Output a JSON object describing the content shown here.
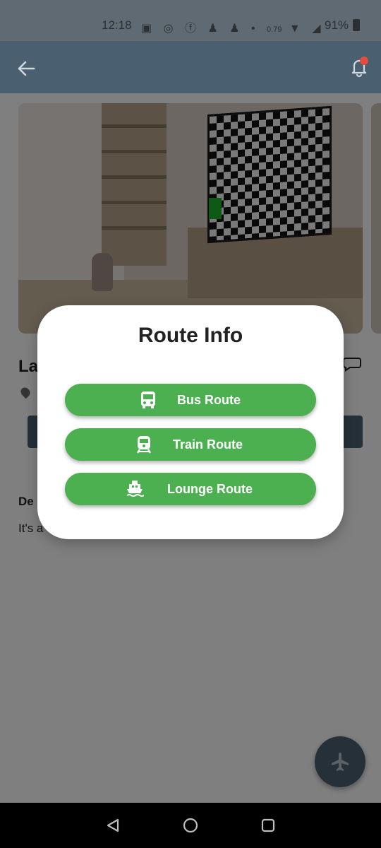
{
  "status_bar": {
    "time": "12:18",
    "icons": [
      "notes-icon",
      "messenger-icon",
      "facebook-icon",
      "person-add-icon",
      "person-add-icon",
      "dot-icon",
      "data-speed-icon",
      "wifi-icon",
      "signal-icon"
    ],
    "data_speed": "0.79",
    "battery": "91%"
  },
  "app_bar": {
    "back_icon": "arrow-left-icon",
    "notification_icon": "bell-icon",
    "notification_badge_color": "#e24b3e",
    "background_color": "#4a6071"
  },
  "background": {
    "title_partial": "La",
    "description_title_partial": "De",
    "description_text_partial": "It's a"
  },
  "dialog": {
    "title": "Route Info",
    "buttons": [
      {
        "label": "Bus Route",
        "icon": "bus-icon"
      },
      {
        "label": "Train Route",
        "icon": "train-icon"
      },
      {
        "label": "Lounge Route",
        "icon": "ship-icon"
      }
    ],
    "button_color": "#4caf50"
  },
  "fab": {
    "icon": "airplane-icon"
  },
  "nav_bar": {
    "buttons": [
      "back-triangle-icon",
      "home-circle-icon",
      "recents-square-icon"
    ]
  }
}
